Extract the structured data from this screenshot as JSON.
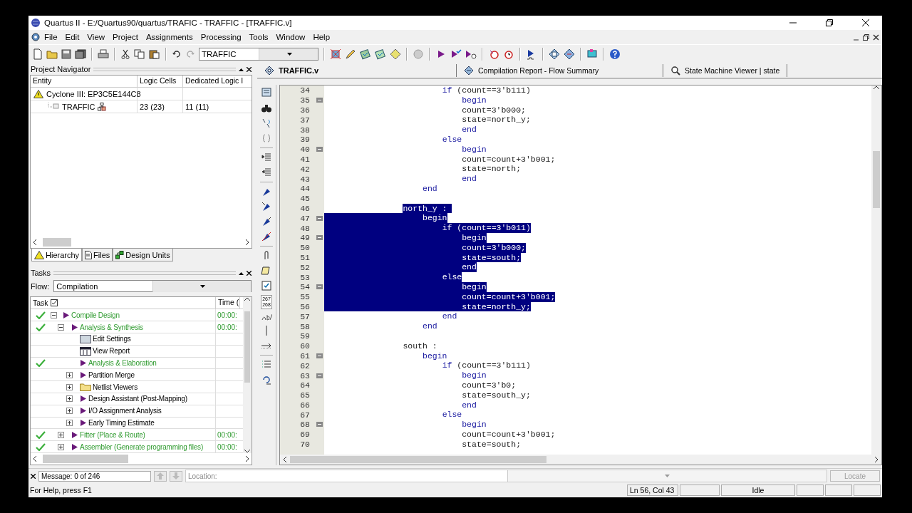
{
  "window": {
    "title": "Quartus II - E:/Quartus90/quartus/TRAFIC - TRAFFIC - [TRAFFIC.v]"
  },
  "menu": [
    "File",
    "Edit",
    "View",
    "Project",
    "Assignments",
    "Processing",
    "Tools",
    "Window",
    "Help"
  ],
  "toolbar": {
    "entity_combo": "TRAFFIC"
  },
  "project_navigator": {
    "title": "Project Navigator",
    "columns": [
      "Entity",
      "Logic Cells",
      "Dedicated Logic I"
    ],
    "rows": [
      {
        "entity": "Cyclone III: EP3C5E144C8",
        "kind": "device",
        "children": [
          {
            "entity": "TRAFFIC",
            "kind": "module",
            "logic_cells": "23 (23)",
            "dedicated_logic": "11 (11)"
          }
        ]
      }
    ],
    "tabs": [
      {
        "label": "Hierarchy",
        "selected": true
      },
      {
        "label": "Files",
        "selected": false
      },
      {
        "label": "Design Units",
        "selected": false
      }
    ]
  },
  "tasks": {
    "title": "Tasks",
    "flow_label": "Flow:",
    "flow": "Compilation",
    "columns": [
      "Task",
      "Time ("
    ],
    "rows": [
      {
        "label": "Compile Design",
        "kind": "task",
        "done": true,
        "expanded": true,
        "time": "00:00:",
        "children": [
          {
            "label": "Analysis & Synthesis",
            "kind": "task",
            "done": true,
            "expanded": true,
            "time": "00:00:",
            "children": [
              {
                "label": "Edit Settings",
                "kind": "settings",
                "done": false
              },
              {
                "label": "View Report",
                "kind": "report",
                "done": false
              },
              {
                "label": "Analysis & Elaboration",
                "kind": "task",
                "done": true
              },
              {
                "label": "Partition Merge",
                "kind": "task",
                "done": false,
                "expanded": false
              },
              {
                "label": "Netlist Viewers",
                "kind": "folder",
                "done": false,
                "expanded": false
              },
              {
                "label": "Design Assistant (Post-Mapping)",
                "kind": "task",
                "done": false,
                "expanded": false
              },
              {
                "label": "I/O Assignment Analysis",
                "kind": "task",
                "done": false,
                "expanded": false
              },
              {
                "label": "Early Timing Estimate",
                "kind": "task",
                "done": false,
                "expanded": false
              }
            ]
          },
          {
            "label": "Fitter (Place & Route)",
            "kind": "task",
            "done": true,
            "expanded": false,
            "time": "00:00:"
          },
          {
            "label": "Assembler (Generate programming files)",
            "kind": "task",
            "done": true,
            "expanded": false,
            "time": "00:00:"
          }
        ]
      }
    ]
  },
  "editor": {
    "tabs": [
      {
        "label": "TRAFFIC.v",
        "selected": true,
        "kind": "file"
      },
      {
        "label": "Compilation Report - Flow Summary",
        "selected": false,
        "kind": "report"
      },
      {
        "label": "State Machine Viewer | state",
        "selected": false,
        "kind": "viewer"
      }
    ],
    "side_numbers": "267\n268",
    "lines": [
      {
        "number": "34",
        "fold": false,
        "selected": false,
        "kind": "branch",
        "code": [
          {
            "text": "if",
            "kind": "keyword"
          },
          {
            "text": " (count==3'b111)",
            "kind": "plain"
          }
        ]
      },
      {
        "number": "35",
        "fold": true,
        "selected": false,
        "kind": "body",
        "code": [
          {
            "text": "begin",
            "kind": "keyword"
          }
        ]
      },
      {
        "number": "36",
        "fold": false,
        "selected": false,
        "kind": "body",
        "code": [
          {
            "text": "count=3'b000;",
            "kind": "plain"
          }
        ]
      },
      {
        "number": "37",
        "fold": false,
        "selected": false,
        "kind": "body",
        "code": [
          {
            "text": "state=north_y;",
            "kind": "plain"
          }
        ]
      },
      {
        "number": "38",
        "fold": false,
        "selected": false,
        "kind": "body",
        "code": [
          {
            "text": "end",
            "kind": "keyword"
          }
        ]
      },
      {
        "number": "39",
        "fold": false,
        "selected": false,
        "kind": "branch",
        "code": [
          {
            "text": "else",
            "kind": "keyword"
          }
        ]
      },
      {
        "number": "40",
        "fold": true,
        "selected": false,
        "kind": "body",
        "code": [
          {
            "text": "begin",
            "kind": "keyword"
          }
        ]
      },
      {
        "number": "41",
        "fold": false,
        "selected": false,
        "kind": "body",
        "code": [
          {
            "text": "count=count+3'b001;",
            "kind": "plain"
          }
        ]
      },
      {
        "number": "42",
        "fold": false,
        "selected": false,
        "kind": "body",
        "code": [
          {
            "text": "state=north;",
            "kind": "plain"
          }
        ]
      },
      {
        "number": "43",
        "fold": false,
        "selected": false,
        "kind": "body",
        "code": [
          {
            "text": "end",
            "kind": "keyword"
          }
        ]
      },
      {
        "number": "44",
        "fold": false,
        "selected": false,
        "kind": "block",
        "code": [
          {
            "text": "end",
            "kind": "keyword"
          }
        ]
      },
      {
        "number": "45",
        "fold": false,
        "kind": "blank"
      },
      {
        "number": "46",
        "fold": false,
        "selected": true,
        "kind": "label",
        "code": [
          {
            "text": "north_y :",
            "kind": "plain"
          }
        ]
      },
      {
        "number": "47",
        "fold": true,
        "selected": true,
        "kind": "block",
        "code": [
          {
            "text": "begin",
            "kind": "keyword"
          }
        ]
      },
      {
        "number": "48",
        "fold": false,
        "selected": true,
        "kind": "branch",
        "code": [
          {
            "text": "if",
            "kind": "keyword"
          },
          {
            "text": " (count==3'b011)",
            "kind": "plain"
          }
        ]
      },
      {
        "number": "49",
        "fold": true,
        "selected": true,
        "kind": "body",
        "code": [
          {
            "text": "begin",
            "kind": "keyword"
          }
        ]
      },
      {
        "number": "50",
        "fold": false,
        "selected": true,
        "kind": "body",
        "code": [
          {
            "text": "count=3'b000;",
            "kind": "plain"
          }
        ]
      },
      {
        "number": "51",
        "fold": false,
        "selected": true,
        "kind": "body",
        "code": [
          {
            "text": "state=south;",
            "kind": "plain"
          }
        ]
      },
      {
        "number": "52",
        "fold": false,
        "selected": true,
        "kind": "body",
        "code": [
          {
            "text": "end",
            "kind": "keyword"
          }
        ]
      },
      {
        "number": "53",
        "fold": false,
        "selected": true,
        "kind": "branch",
        "code": [
          {
            "text": "else",
            "kind": "keyword"
          }
        ]
      },
      {
        "number": "54",
        "fold": true,
        "selected": true,
        "kind": "body",
        "code": [
          {
            "text": "begin",
            "kind": "keyword"
          }
        ]
      },
      {
        "number": "55",
        "fold": false,
        "selected": true,
        "kind": "body",
        "code": [
          {
            "text": "count=count+3'b001;",
            "kind": "plain"
          }
        ]
      },
      {
        "number": "56",
        "fold": false,
        "selected": true,
        "kind": "body",
        "code": [
          {
            "text": "state=north_y;",
            "kind": "plain"
          }
        ]
      },
      {
        "number": "57",
        "fold": false,
        "selected": false,
        "kind": "branch",
        "code": [
          {
            "text": "end",
            "kind": "keyword"
          }
        ]
      },
      {
        "number": "58",
        "fold": false,
        "selected": false,
        "kind": "block",
        "code": [
          {
            "text": "end",
            "kind": "keyword"
          }
        ]
      },
      {
        "number": "59",
        "fold": false,
        "kind": "blank"
      },
      {
        "number": "60",
        "fold": false,
        "selected": false,
        "kind": "label",
        "code": [
          {
            "text": "south :",
            "kind": "plain"
          }
        ]
      },
      {
        "number": "61",
        "fold": true,
        "selected": false,
        "kind": "block",
        "code": [
          {
            "text": "begin",
            "kind": "keyword"
          }
        ]
      },
      {
        "number": "62",
        "fold": false,
        "selected": false,
        "kind": "branch",
        "code": [
          {
            "text": "if",
            "kind": "keyword"
          },
          {
            "text": " (count==3'b111)",
            "kind": "plain"
          }
        ]
      },
      {
        "number": "63",
        "fold": true,
        "selected": false,
        "kind": "body",
        "code": [
          {
            "text": "begin",
            "kind": "keyword"
          }
        ]
      },
      {
        "number": "64",
        "fold": false,
        "selected": false,
        "kind": "body",
        "code": [
          {
            "text": "count=3'b0;",
            "kind": "plain"
          }
        ]
      },
      {
        "number": "65",
        "fold": false,
        "selected": false,
        "kind": "body",
        "code": [
          {
            "text": "state=south_y;",
            "kind": "plain"
          }
        ]
      },
      {
        "number": "66",
        "fold": false,
        "selected": false,
        "kind": "body",
        "code": [
          {
            "text": "end",
            "kind": "keyword"
          }
        ]
      },
      {
        "number": "67",
        "fold": false,
        "selected": false,
        "kind": "branch",
        "code": [
          {
            "text": "else",
            "kind": "keyword"
          }
        ]
      },
      {
        "number": "68",
        "fold": true,
        "selected": false,
        "kind": "body",
        "code": [
          {
            "text": "begin",
            "kind": "keyword"
          }
        ]
      },
      {
        "number": "69",
        "fold": false,
        "selected": false,
        "kind": "body",
        "code": [
          {
            "text": "count=count+3'b001;",
            "kind": "plain"
          }
        ]
      },
      {
        "number": "70",
        "fold": false,
        "selected": false,
        "kind": "body",
        "code": [
          {
            "text": "state=south;",
            "kind": "plain"
          }
        ]
      }
    ]
  },
  "message_bar": {
    "message": "Message: 0 of 246",
    "location_label": "Location:",
    "locate_button": "Locate"
  },
  "status_bar": {
    "help": "For Help, press F1",
    "position": "Ln 56, Col 43",
    "state": "Idle"
  }
}
